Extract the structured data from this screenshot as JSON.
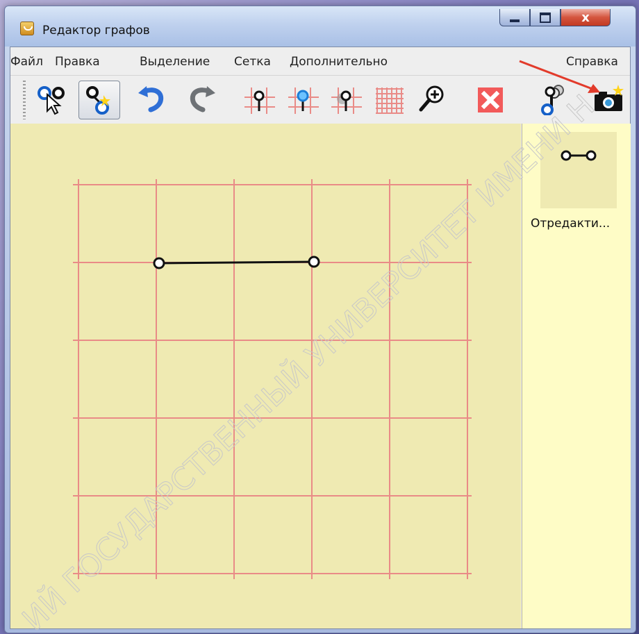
{
  "window": {
    "title": "Редактор графов"
  },
  "menubar": {
    "items": [
      "Файл",
      "Правка",
      "Выделение",
      "Сетка",
      "Дополнительно"
    ],
    "help": "Справка"
  },
  "toolbar": {
    "tools": [
      {
        "icon": "select-pointer-icon",
        "active": false
      },
      {
        "icon": "add-vertex-icon",
        "active": true
      },
      {
        "icon": "undo-icon",
        "active": false
      },
      {
        "icon": "redo-icon",
        "active": false
      },
      {
        "icon": "grid-vertex-icon",
        "active": false
      },
      {
        "icon": "grid-vertex-blue-icon",
        "active": false
      },
      {
        "icon": "grid-vertex-shadow-icon",
        "active": false
      },
      {
        "icon": "grid-icon",
        "active": false
      },
      {
        "icon": "zoom-in-icon",
        "active": false
      },
      {
        "icon": "delete-icon",
        "active": false
      },
      {
        "icon": "graph-tool-icon",
        "active": false
      },
      {
        "icon": "snapshot-camera-icon",
        "active": false
      }
    ]
  },
  "side_panel": {
    "thumbnail_label": "Отредакти..."
  },
  "watermark": {
    "text": "ИЙ ГОСУДАРСТВЕННЫЙ УНИВЕРСИТЕТ ИМЕНИ Н"
  },
  "colors": {
    "canvas_bg": "#efeab2",
    "side_bg": "#fefcc6",
    "grid_line": "#e98b87",
    "edge": "#111111",
    "arrow": "#e23b2b"
  }
}
